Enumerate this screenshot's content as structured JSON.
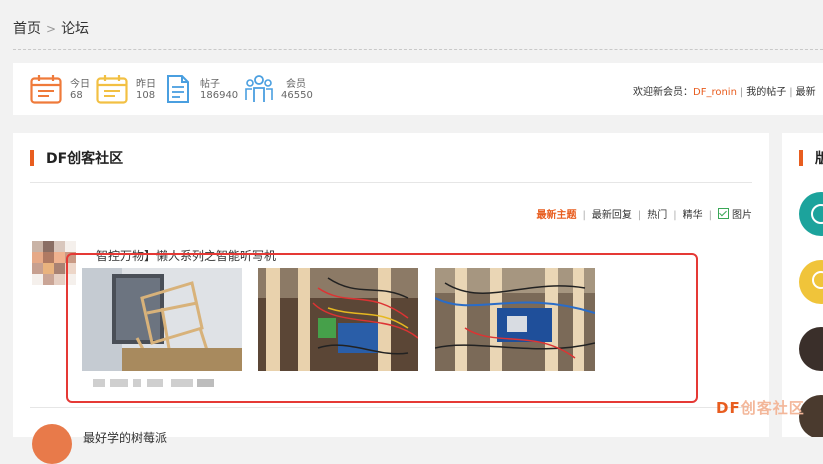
{
  "breadcrumb": {
    "home": "首页",
    "separator": ">",
    "current": "论坛"
  },
  "stats": {
    "today": {
      "label": "今日",
      "value": "68"
    },
    "yesterday": {
      "label": "昨日",
      "value": "108"
    },
    "posts": {
      "label": "帖子",
      "value": "186940"
    },
    "members": {
      "label": "会员",
      "value": "46550"
    }
  },
  "welcome": {
    "prefix": "欢迎新会员：",
    "username": "DF_ronin",
    "my_posts": "我的帖子",
    "latest": "最新"
  },
  "section": {
    "title": "DF创客社区",
    "filters": {
      "newest_topics": "最新主题",
      "newest_replies": "最新回复",
      "hot": "热门",
      "featured": "精华",
      "images": "图片"
    }
  },
  "posts": [
    {
      "title": "智控万物】懒人系列之智能听写机"
    },
    {
      "title": "最好学的树莓派"
    }
  ],
  "sidebar": {
    "title": "版"
  },
  "watermark": {
    "brand": "DF",
    "rest": "创客社区"
  },
  "colors": {
    "accent": "#e85d1f",
    "highlight_box": "#e53935",
    "check": "#3aa757"
  }
}
